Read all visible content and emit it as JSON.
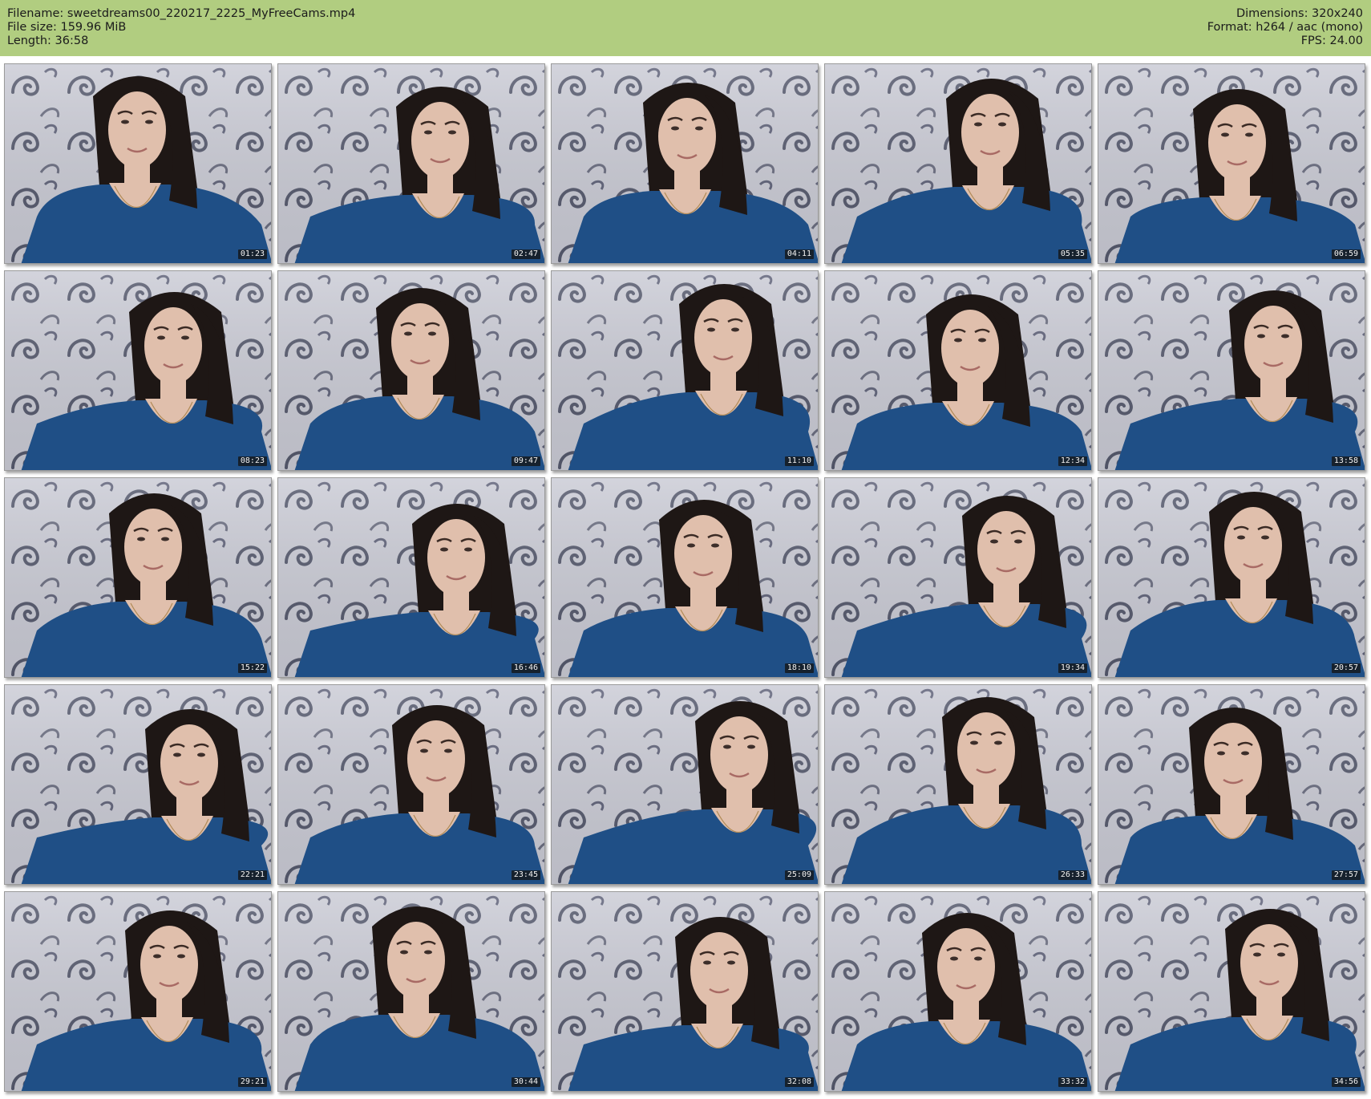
{
  "header": {
    "filename": "Filename: sweetdreams00_220217_2225_MyFreeCams.mp4",
    "filesize": "File size: 159.96 MiB",
    "length": "Length: 36:58",
    "dimensions": "Dimensions: 320x240",
    "format": "Format: h264 / aac (mono)",
    "fps": "FPS: 24.00"
  },
  "colors": {
    "header_bg": "#b1cd80",
    "wallpaper": "#cbccd6",
    "shirt": "#1f4f86",
    "hair": "#1e1715",
    "skin": "#e0bfac"
  },
  "thumbnails": [
    {
      "timestamp": "01:23"
    },
    {
      "timestamp": "02:47"
    },
    {
      "timestamp": "04:11"
    },
    {
      "timestamp": "05:35"
    },
    {
      "timestamp": "06:59"
    },
    {
      "timestamp": "08:23"
    },
    {
      "timestamp": "09:47"
    },
    {
      "timestamp": "11:10"
    },
    {
      "timestamp": "12:34"
    },
    {
      "timestamp": "13:58"
    },
    {
      "timestamp": "15:22"
    },
    {
      "timestamp": "16:46"
    },
    {
      "timestamp": "18:10"
    },
    {
      "timestamp": "19:34"
    },
    {
      "timestamp": "20:57"
    },
    {
      "timestamp": "22:21"
    },
    {
      "timestamp": "23:45"
    },
    {
      "timestamp": "25:09"
    },
    {
      "timestamp": "26:33"
    },
    {
      "timestamp": "27:57"
    },
    {
      "timestamp": "29:21"
    },
    {
      "timestamp": "30:44"
    },
    {
      "timestamp": "32:08"
    },
    {
      "timestamp": "33:32"
    },
    {
      "timestamp": "34:56"
    }
  ]
}
